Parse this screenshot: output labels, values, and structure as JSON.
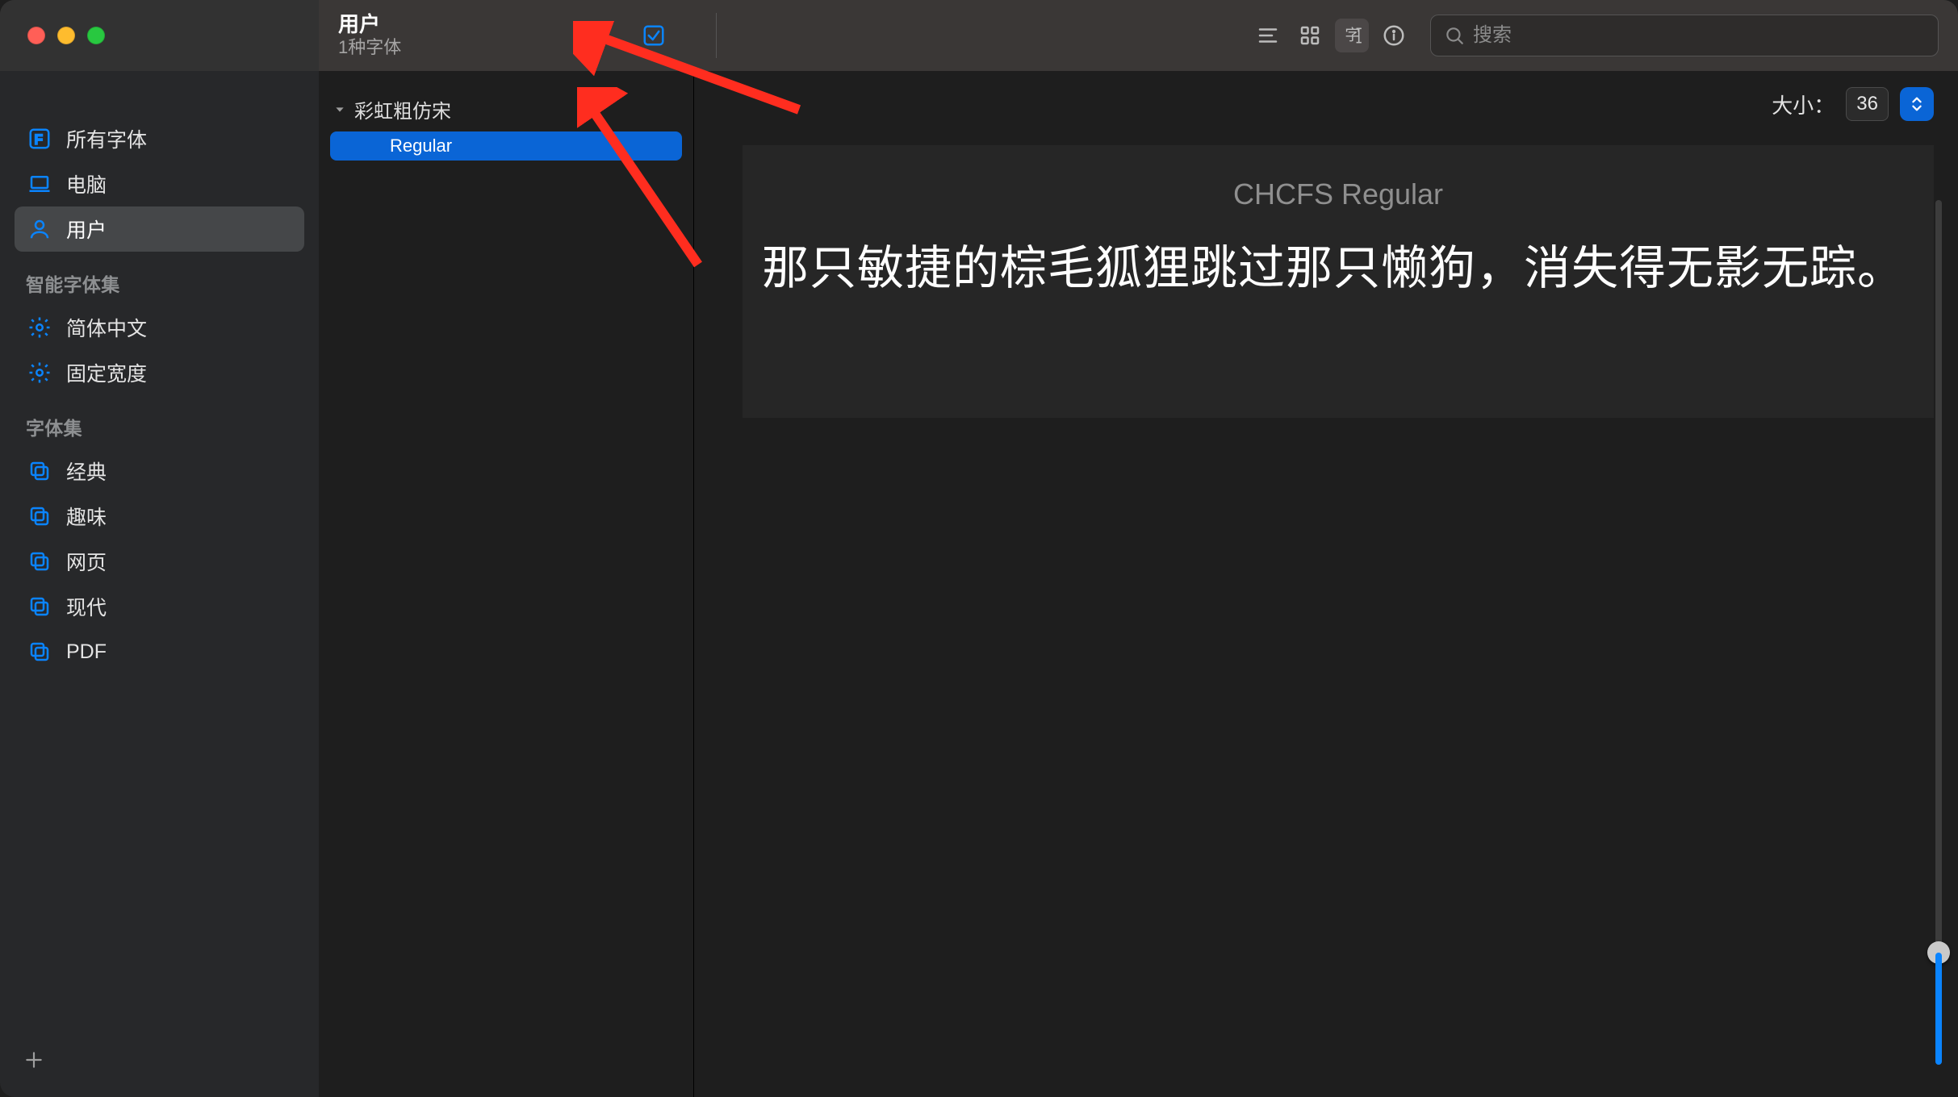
{
  "header": {
    "title": "用户",
    "subtitle": "1种字体"
  },
  "toolbar": {
    "search_placeholder": "搜索"
  },
  "sidebar": {
    "group1": [
      {
        "icon": "font-icon",
        "label": "所有字体"
      },
      {
        "icon": "laptop-icon",
        "label": "电脑"
      },
      {
        "icon": "user-icon",
        "label": "用户",
        "selected": true
      }
    ],
    "section_smart_header": "智能字体集",
    "group_smart": [
      {
        "icon": "gear-icon",
        "label": "简体中文"
      },
      {
        "icon": "gear-icon",
        "label": "固定宽度"
      }
    ],
    "section_collections_header": "字体集",
    "group_collections": [
      {
        "icon": "copy-icon",
        "label": "经典"
      },
      {
        "icon": "copy-icon",
        "label": "趣味"
      },
      {
        "icon": "copy-icon",
        "label": "网页"
      },
      {
        "icon": "copy-icon",
        "label": "现代"
      },
      {
        "icon": "copy-icon",
        "label": "PDF"
      }
    ]
  },
  "fontlist": {
    "family": "彩虹粗仿宋",
    "styles": [
      {
        "label": "Regular",
        "selected": true
      }
    ]
  },
  "preview": {
    "size_label": "大小：",
    "size_value": "36",
    "font_display_name": "CHCFS Regular",
    "sample_text": "那只敏捷的棕毛狐狸跳过那只懒狗，消失得无影无踪。"
  }
}
